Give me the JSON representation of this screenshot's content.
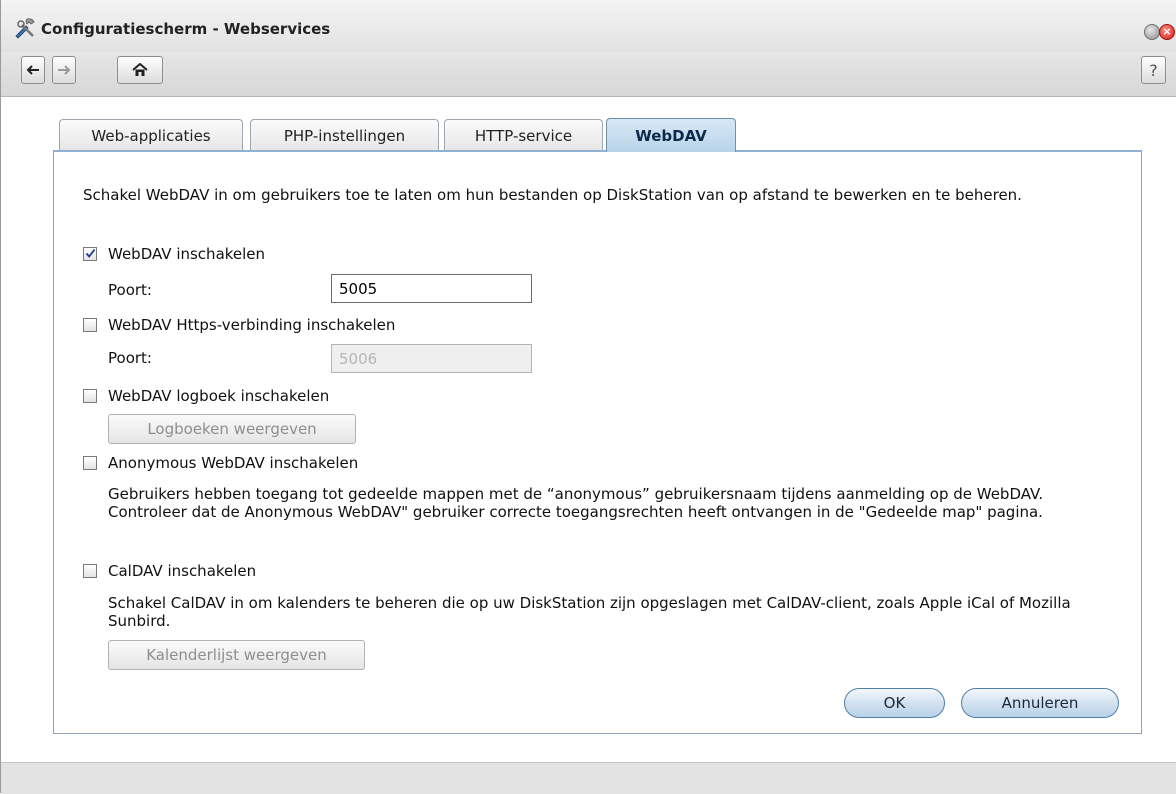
{
  "window": {
    "title": "Configuratiescherm - Webservices",
    "help_label": "?"
  },
  "tabs": [
    {
      "label": "Web-applicaties",
      "active": false
    },
    {
      "label": "PHP-instellingen",
      "active": false
    },
    {
      "label": "HTTP-service",
      "active": false
    },
    {
      "label": "WebDAV",
      "active": true
    }
  ],
  "webdav": {
    "description": "Schakel WebDAV in om gebruikers toe te laten om hun bestanden op DiskStation van op afstand te bewerken en te beheren.",
    "enable_label": "WebDAV inschakelen",
    "enable_checked": true,
    "port_label": "Poort:",
    "port_value": "5005",
    "https_label": "WebDAV Https-verbinding inschakelen",
    "https_checked": false,
    "https_port_label": "Poort:",
    "https_port_value": "5006",
    "log_label": "WebDAV logboek inschakelen",
    "log_checked": false,
    "log_button": "Logboeken weergeven",
    "anon_label": "Anonymous WebDAV inschakelen",
    "anon_checked": false,
    "anon_description": "Gebruikers hebben toegang tot gedeelde mappen met de “anonymous” gebruikersnaam tijdens aanmelding op de WebDAV. Controleer dat de Anonymous WebDAV\" gebruiker correcte toegangsrechten heeft ontvangen in de \"Gedeelde map\" pagina.",
    "caldav_label": "CalDAV inschakelen",
    "caldav_checked": false,
    "caldav_description": "Schakel CalDAV in om kalenders te beheren die op uw DiskStation zijn opgeslagen met CalDAV-client, zoals Apple iCal of Mozilla Sunbird.",
    "calendar_button": "Kalenderlijst weergeven"
  },
  "actions": {
    "ok": "OK",
    "cancel": "Annuleren"
  },
  "colors": {
    "active_tab": "#b8d3ea",
    "pill_button": "#cfe0ef",
    "close_button": "#d0201a"
  },
  "icons": [
    "tools-icon",
    "minimize-icon",
    "close-icon",
    "back-arrow-icon",
    "forward-arrow-icon",
    "home-icon",
    "help-icon",
    "checkmark-icon"
  ]
}
